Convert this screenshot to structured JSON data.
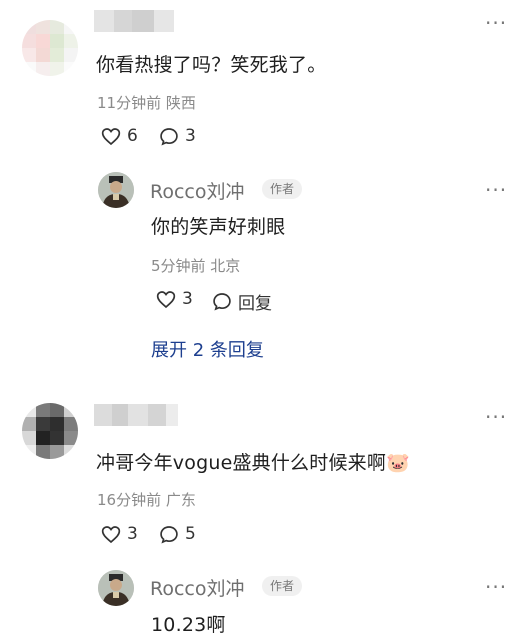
{
  "comment1": {
    "text": "你看热搜了吗？笑死我了。",
    "meta": "11分钟前 陕西",
    "likes": "6",
    "replies": "3"
  },
  "reply1": {
    "username": "Rocco刘冲",
    "badge": "作者",
    "text": "你的笑声好刺眼",
    "meta": "5分钟前 北京",
    "likes": "3",
    "reply_label": "回复"
  },
  "expand": {
    "label": "展开 2 条回复"
  },
  "comment2": {
    "text": "冲哥今年vogue盛典什么时候来啊",
    "emoji": "🐷",
    "meta": "16分钟前 广东",
    "likes": "3",
    "replies": "5"
  },
  "reply2": {
    "username": "Rocco刘冲",
    "badge": "作者",
    "text": "10.23啊"
  },
  "icons": {
    "more": "more-icon",
    "like": "heart-icon",
    "comment": "comment-bubble-icon",
    "reply": "reply-bubble-icon"
  },
  "colors": {
    "link": "#1d3f8f",
    "meta": "#8a8a8a",
    "badge_bg": "#f0f0f0"
  }
}
